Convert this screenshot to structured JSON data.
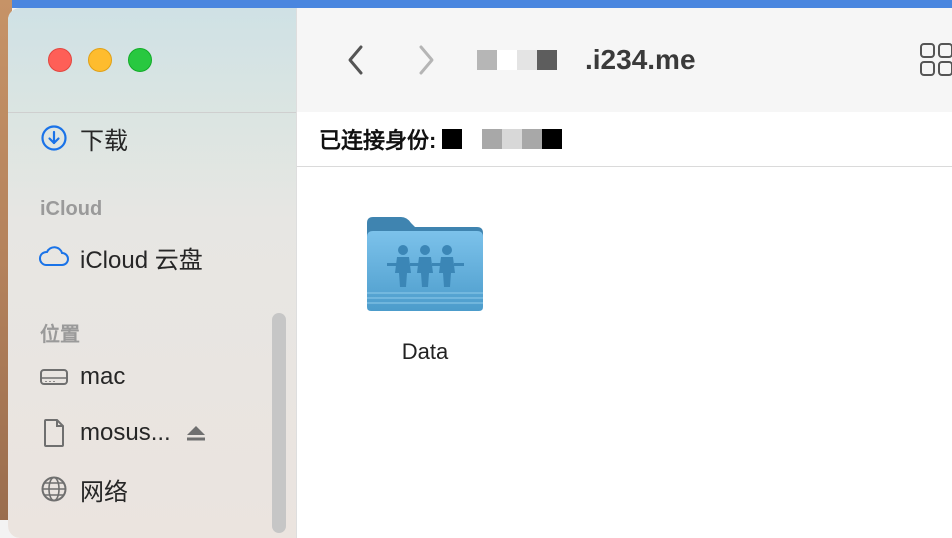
{
  "sidebar": {
    "items_top": [
      {
        "label": "下载",
        "icon": "download-icon"
      }
    ],
    "icloud_section": {
      "title": "iCloud",
      "items": [
        {
          "label": "iCloud 云盘",
          "icon": "cloud-icon"
        }
      ]
    },
    "location_section": {
      "title": "位置",
      "items": [
        {
          "label": "mac",
          "icon": "drive-icon"
        },
        {
          "label": "mosus...",
          "icon": "document-icon",
          "eject": "eject-icon"
        },
        {
          "label": "网络",
          "icon": "globe-icon"
        }
      ]
    }
  },
  "toolbar": {
    "title_visible": ".i234.me",
    "back": "chevron-left-icon",
    "forward": "chevron-right-icon",
    "view": "grid-view-icon"
  },
  "connection": {
    "label": "已连接身份:"
  },
  "files": [
    {
      "name": "Data",
      "icon": "shared-folder-icon"
    }
  ],
  "colors": {
    "accent": "#1a73e8",
    "folder": "#5aa7d6",
    "close": "#fe5f57",
    "minimize": "#febc2e",
    "zoom": "#28c840"
  }
}
